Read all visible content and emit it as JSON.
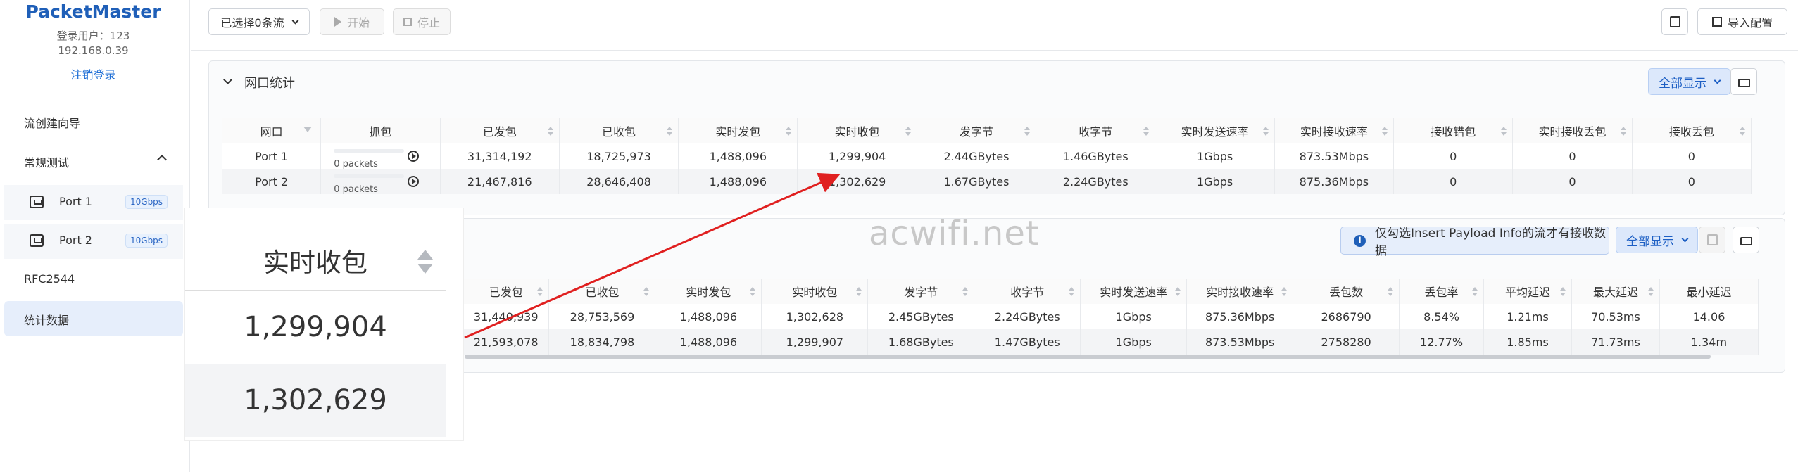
{
  "sidebar": {
    "brand": "PacketMaster",
    "user": "登录用户：123",
    "ip": "192.168.0.39",
    "logout": "注销登录",
    "items": [
      {
        "label": "流创建向导"
      },
      {
        "label": "常规测试"
      },
      {
        "label": "Port 1",
        "speed": "10Gbps"
      },
      {
        "label": "Port 2",
        "speed": "10Gbps"
      },
      {
        "label": "RFC2544"
      },
      {
        "label": "统计数据"
      }
    ]
  },
  "toolbar": {
    "select_flows": "已选择0条流",
    "start": "开始",
    "stop": "停止",
    "import": "导入配置"
  },
  "port_stats": {
    "title": "网口统计",
    "show_all": "全部显示",
    "headers": [
      "网口",
      "抓包",
      "已发包",
      "已收包",
      "实时发包",
      "实时收包",
      "发字节",
      "收字节",
      "实时发送速率",
      "实时接收速率",
      "接收错包",
      "实时接收丢包",
      "接收丢包"
    ],
    "rows": [
      [
        "Port 1",
        "0 packets",
        "31,314,192",
        "18,725,973",
        "1,488,096",
        "1,299,904",
        "2.44GBytes",
        "1.46GBytes",
        "1Gbps",
        "873.53Mbps",
        "0",
        "0",
        "0"
      ],
      [
        "Port 2",
        "0 packets",
        "21,467,816",
        "28,646,408",
        "1,488,096",
        "1,302,629",
        "1.67GBytes",
        "2.24GBytes",
        "1Gbps",
        "875.36Mbps",
        "0",
        "0",
        "0"
      ]
    ]
  },
  "flow_stats": {
    "info": "仅勾选Insert Payload Info的流才有接收数据",
    "show_all": "全部显示",
    "headers": [
      "已发包",
      "已收包",
      "实时发包",
      "实时收包",
      "发字节",
      "收字节",
      "实时发送速率",
      "实时接收速率",
      "丢包数",
      "丢包率",
      "平均延迟",
      "最大延迟",
      "最小延迟"
    ],
    "rows": [
      [
        "31,440,939",
        "28,753,569",
        "1,488,096",
        "1,302,628",
        "2.45GBytes",
        "2.24GBytes",
        "1Gbps",
        "875.36Mbps",
        "2686790",
        "8.54%",
        "1.21ms",
        "70.53ms",
        "14.06"
      ],
      [
        "21,593,078",
        "18,834,798",
        "1,488,096",
        "1,299,907",
        "1.68GBytes",
        "1.47GBytes",
        "1Gbps",
        "873.53Mbps",
        "2758280",
        "12.77%",
        "1.85ms",
        "71.73ms",
        "1.34m"
      ]
    ]
  },
  "zoom": {
    "header": "实时收包",
    "values": [
      "1,299,904",
      "1,302,629"
    ]
  },
  "watermark": "acwifi.net",
  "colors": {
    "accent": "#1f5fb8",
    "arrow": "#e02020"
  }
}
